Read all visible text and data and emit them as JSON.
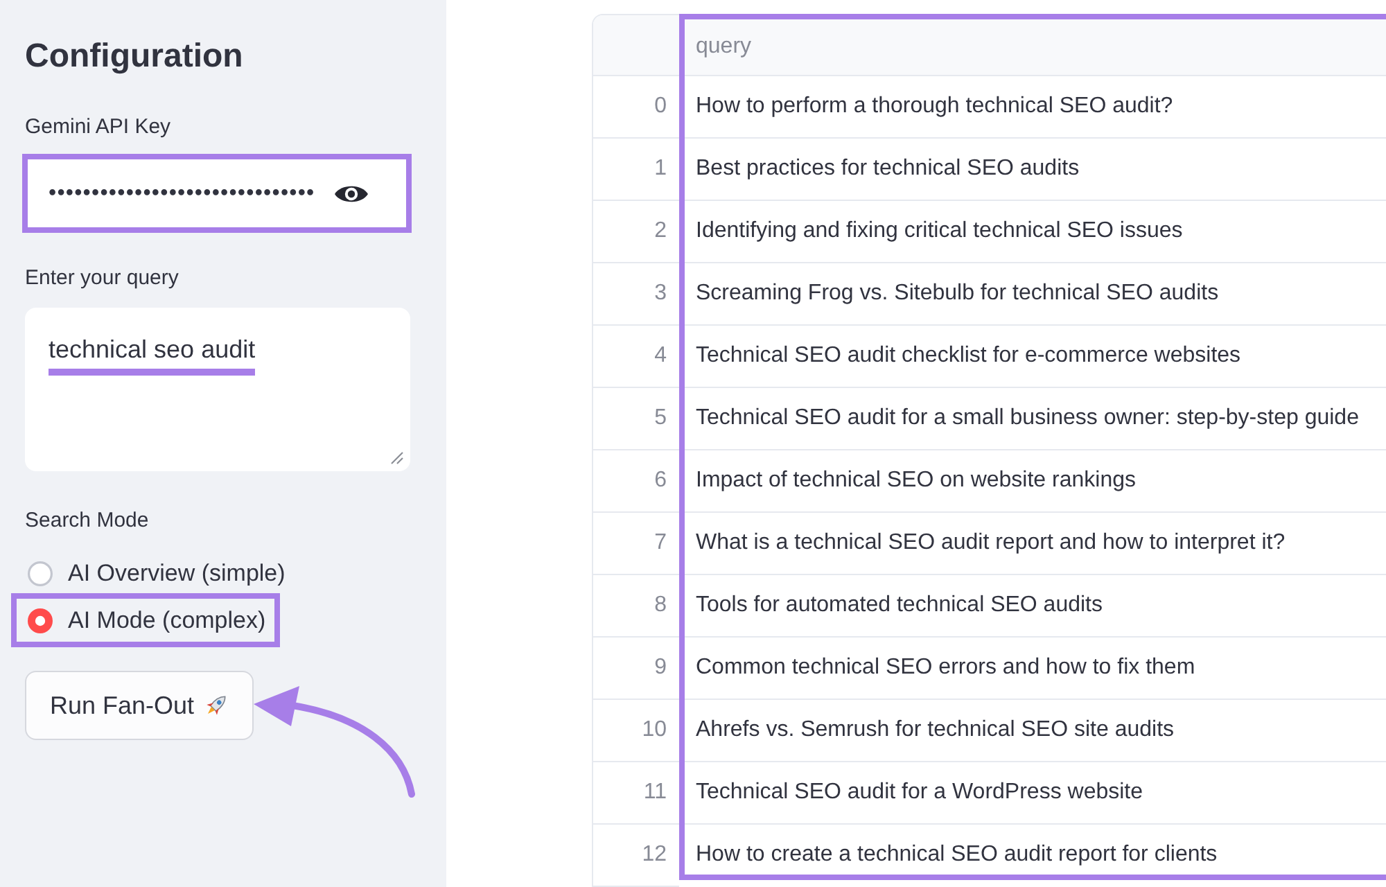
{
  "sidebar": {
    "title": "Configuration",
    "api_key": {
      "label": "Gemini API Key",
      "value": "•••••••••••••••••••••••••••••••",
      "highlighted": true
    },
    "query": {
      "label": "Enter your query",
      "value": "technical seo audit",
      "underlined": true
    },
    "search_mode": {
      "label": "Search Mode",
      "options": [
        {
          "label": "AI Overview (simple)",
          "selected": false,
          "highlighted": false
        },
        {
          "label": "AI Mode (complex)",
          "selected": true,
          "highlighted": true
        }
      ]
    },
    "run_button": {
      "label": "Run Fan-Out",
      "pointed_at": true
    }
  },
  "table": {
    "columns": [
      {
        "label": "query",
        "highlighted": true
      }
    ],
    "rows": [
      {
        "index": "0",
        "query": "How to perform a thorough technical SEO audit?"
      },
      {
        "index": "1",
        "query": "Best practices for technical SEO audits"
      },
      {
        "index": "2",
        "query": "Identifying and fixing critical technical SEO issues"
      },
      {
        "index": "3",
        "query": "Screaming Frog vs. Sitebulb for technical SEO audits"
      },
      {
        "index": "4",
        "query": "Technical SEO audit checklist for e-commerce websites"
      },
      {
        "index": "5",
        "query": "Technical SEO audit for a small business owner: step-by-step guide"
      },
      {
        "index": "6",
        "query": "Impact of technical SEO on website rankings"
      },
      {
        "index": "7",
        "query": "What is a technical SEO audit report and how to interpret it?"
      },
      {
        "index": "8",
        "query": "Tools for automated technical SEO audits"
      },
      {
        "index": "9",
        "query": "Common technical SEO errors and how to fix them"
      },
      {
        "index": "10",
        "query": "Ahrefs vs. Semrush for technical SEO site audits"
      },
      {
        "index": "11",
        "query": "Technical SEO audit for a WordPress website"
      },
      {
        "index": "12",
        "query": "How to create a technical SEO audit report for clients"
      }
    ]
  }
}
